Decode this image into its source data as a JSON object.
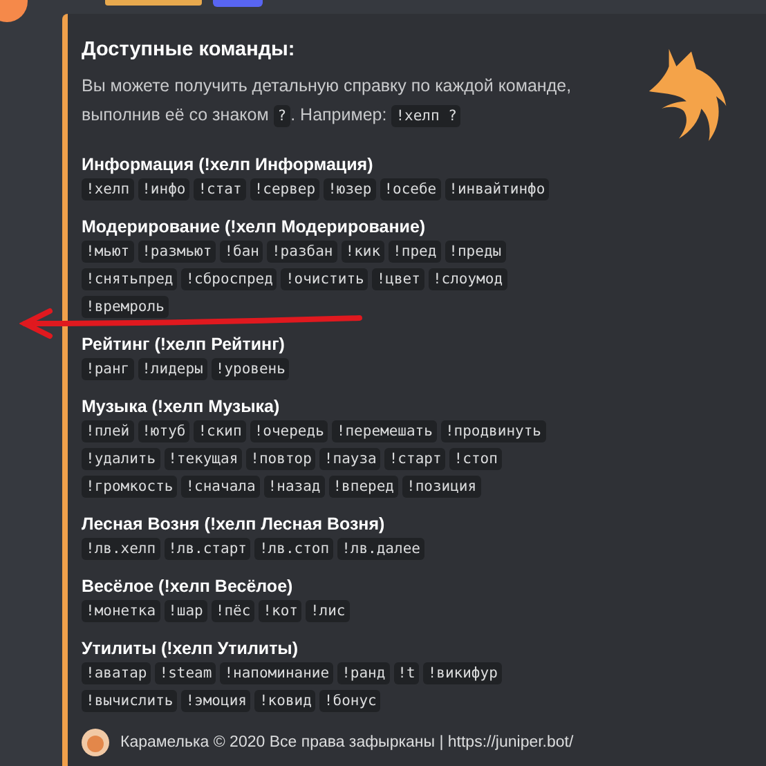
{
  "embed": {
    "title": "Доступные команды:",
    "description": [
      {
        "kind": "text",
        "text": "Вы можете получить детальную справку по каждой команде, выполнив её со знаком "
      },
      {
        "kind": "code",
        "text": "?"
      },
      {
        "kind": "text",
        "text": ". Например: "
      },
      {
        "kind": "code",
        "text": "!хелп ?"
      }
    ],
    "sections": [
      {
        "heading": "Информация (!хелп Информация)",
        "commands": [
          "!хелп",
          "!инфо",
          "!стат",
          "!сервер",
          "!юзер",
          "!осебе",
          "!инвайтинфо"
        ]
      },
      {
        "heading": "Модерирование (!хелп Модерирование)",
        "commands": [
          "!мьют",
          "!размьют",
          "!бан",
          "!разбан",
          "!кик",
          "!пред",
          "!преды",
          "!снятьпред",
          "!сброспред",
          "!очистить",
          "!цвет",
          "!слоумод",
          "!времроль"
        ]
      },
      {
        "heading": "Рейтинг (!хелп Рейтинг)",
        "commands": [
          "!ранг",
          "!лидеры",
          "!уровень"
        ]
      },
      {
        "heading": "Музыка (!хелп Музыка)",
        "commands": [
          "!плей",
          "!ютуб",
          "!скип",
          "!очередь",
          "!перемешать",
          "!продвинуть",
          "!удалить",
          "!текущая",
          "!повтор",
          "!пауза",
          "!старт",
          "!стоп",
          "!громкость",
          "!сначала",
          "!назад",
          "!вперед",
          "!позиция"
        ]
      },
      {
        "heading": "Лесная Возня (!хелп Лесная Возня)",
        "commands": [
          "!лв.хелп",
          "!лв.старт",
          "!лв.стоп",
          "!лв.далее"
        ]
      },
      {
        "heading": "Весёлое (!хелп Весёлое)",
        "commands": [
          "!монетка",
          "!шар",
          "!пёс",
          "!кот",
          "!лис"
        ]
      },
      {
        "heading": "Утилиты (!хелп Утилиты)",
        "commands": [
          "!аватар",
          "!steam",
          "!напоминание",
          "!ранд",
          "!t",
          "!викифур",
          "!вычислить",
          "!эмоция",
          "!ковид",
          "!бонус"
        ]
      }
    ],
    "footer": {
      "text": "Карамелька © 2020 Все права зафырканы | https://juniper.bot/"
    }
  }
}
